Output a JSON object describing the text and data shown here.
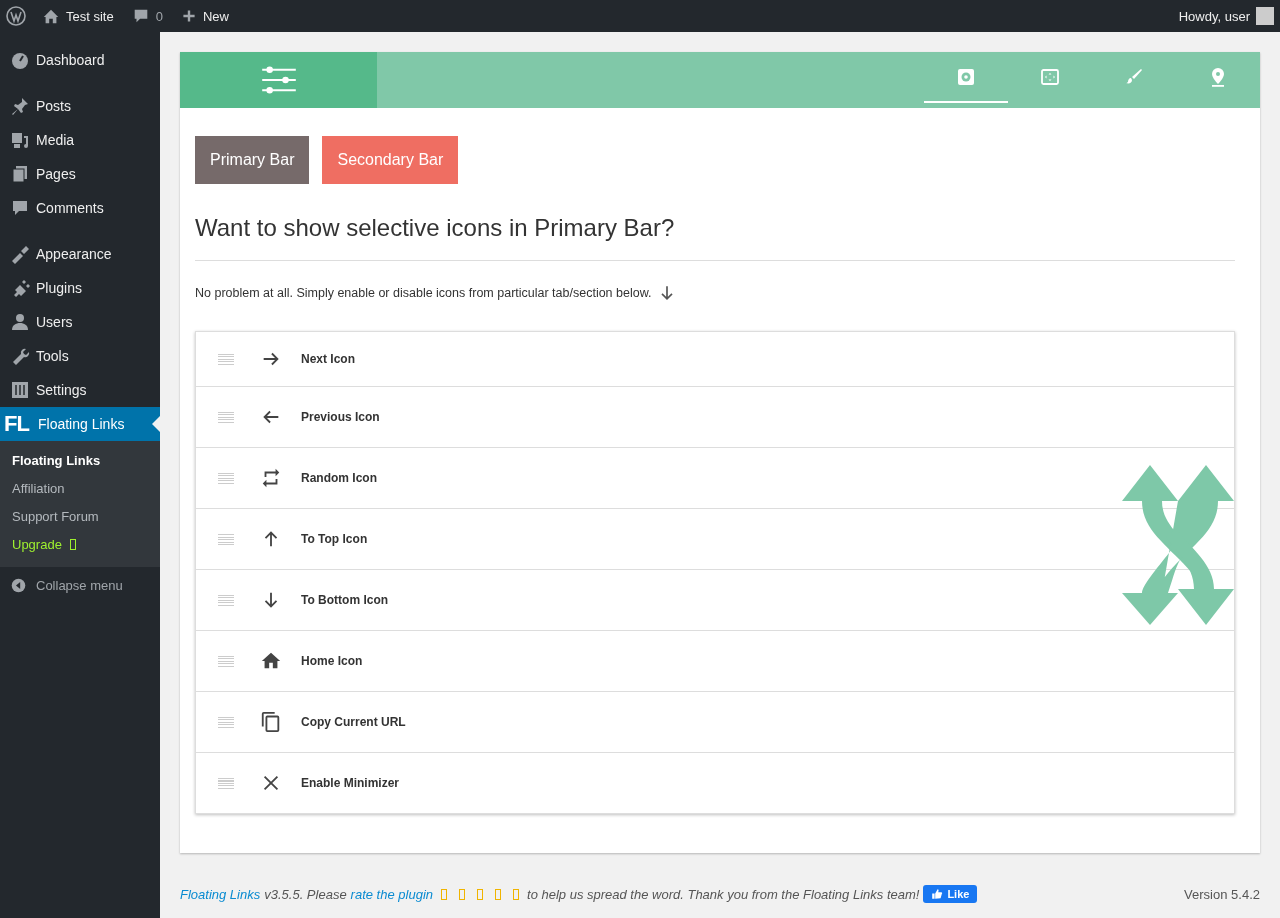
{
  "admin_bar": {
    "site": "Test site",
    "comments": "0",
    "new": "New",
    "greeting": "Howdy, user"
  },
  "sidebar": {
    "items": [
      {
        "label": "Dashboard",
        "kind": "dashboard",
        "selected": false
      },
      {
        "label": "Posts",
        "kind": "posts",
        "selected": false
      },
      {
        "label": "Media",
        "kind": "media",
        "selected": false
      },
      {
        "label": "Pages",
        "kind": "pages",
        "selected": false
      },
      {
        "label": "Comments",
        "kind": "comments",
        "selected": false
      },
      {
        "label": "Appearance",
        "kind": "appearance",
        "selected": false
      },
      {
        "label": "Plugins",
        "kind": "plugins",
        "selected": false
      },
      {
        "label": "Users",
        "kind": "users",
        "selected": false
      },
      {
        "label": "Tools",
        "kind": "tools",
        "selected": false
      },
      {
        "label": "Settings",
        "kind": "settings",
        "selected": false
      },
      {
        "label": "Floating Links",
        "kind": "fl",
        "selected": true,
        "logo": "FL"
      }
    ],
    "submenu": [
      {
        "label": "Floating Links",
        "kind": "link",
        "selected": true
      },
      {
        "label": "Affiliation",
        "kind": "link",
        "selected": false
      },
      {
        "label": "Support Forum",
        "kind": "link",
        "selected": false
      },
      {
        "label": "Upgrade",
        "kind": "upgrade",
        "selected": false
      }
    ],
    "collapse": "Collapse menu"
  },
  "header": {
    "tabs": [
      {
        "selected": true
      },
      {
        "selected": false
      },
      {
        "selected": false
      },
      {
        "selected": false
      }
    ]
  },
  "bar_buttons": [
    {
      "label": "Primary Bar",
      "color": "#766a6a"
    },
    {
      "label": "Secondary Bar",
      "color": "#ef6e62"
    }
  ],
  "heading": "Want to show selective icons in Primary Bar?",
  "intro": "No problem at all. Simply enable or disable icons from particular tab/section below.",
  "icons": [
    {
      "label": "Next Icon",
      "kind": "next"
    },
    {
      "label": "Previous Icon",
      "kind": "previous"
    },
    {
      "label": "Random Icon",
      "kind": "random"
    },
    {
      "label": "To Top Icon",
      "kind": "top"
    },
    {
      "label": "To Bottom Icon",
      "kind": "bottom"
    },
    {
      "label": "Home Icon",
      "kind": "home"
    },
    {
      "label": "Copy Current URL",
      "kind": "copy"
    },
    {
      "label": "Enable Minimizer",
      "kind": "minimizer"
    }
  ],
  "footer": {
    "plugin_link": "Floating Links",
    "text_1": "v3.5.5. Please",
    "rate_link": "rate the plugin",
    "text_2": "to help us spread the word. Thank you from the Floating Links team!",
    "like": "Like",
    "version": "Version 5.4.2"
  }
}
